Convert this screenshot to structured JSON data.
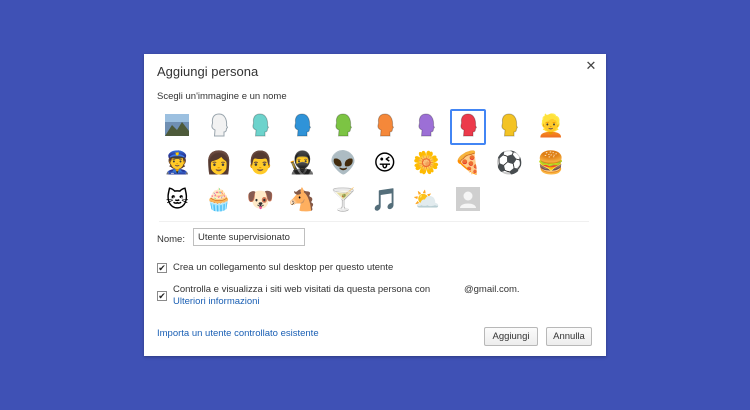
{
  "dialog": {
    "title": "Aggiungi persona",
    "close_glyph": "✕",
    "subtitle": "Scegli un'immagine e un nome"
  },
  "avatars": [
    {
      "icon": "landscape-photo-icon",
      "type": "photo"
    },
    {
      "icon": "head-white-icon",
      "type": "head",
      "color": "#f2f2f2"
    },
    {
      "icon": "head-teal-icon",
      "type": "head",
      "color": "#6dd3cc"
    },
    {
      "icon": "head-blue-icon",
      "type": "head",
      "color": "#2f93d8"
    },
    {
      "icon": "head-green-icon",
      "type": "head",
      "color": "#7cc443"
    },
    {
      "icon": "head-orange-icon",
      "type": "head",
      "color": "#f5883a"
    },
    {
      "icon": "head-purple-icon",
      "type": "head",
      "color": "#9c6fd6"
    },
    {
      "icon": "head-red-icon",
      "type": "head",
      "color": "#ec3a4b",
      "selected": true
    },
    {
      "icon": "head-yellow-icon",
      "type": "head",
      "color": "#f3c324"
    },
    {
      "icon": "blonde-woman-icon",
      "type": "emoji",
      "glyph": "👱"
    },
    {
      "icon": "cop-icon",
      "type": "emoji",
      "glyph": "👮"
    },
    {
      "icon": "woman-sunglasses-icon",
      "type": "emoji",
      "glyph": "👩"
    },
    {
      "icon": "man-icon",
      "type": "emoji",
      "glyph": "👨"
    },
    {
      "icon": "ninja-icon",
      "type": "emoji",
      "glyph": "🥷"
    },
    {
      "icon": "alien-icon",
      "type": "emoji",
      "glyph": "👽"
    },
    {
      "icon": "smiley-icon",
      "type": "emoji",
      "glyph": "😜"
    },
    {
      "icon": "flower-icon",
      "type": "emoji",
      "glyph": "🌼"
    },
    {
      "icon": "pizza-icon",
      "type": "emoji",
      "glyph": "🍕"
    },
    {
      "icon": "soccer-ball-icon",
      "type": "emoji",
      "glyph": "⚽"
    },
    {
      "icon": "burger-icon",
      "type": "emoji",
      "glyph": "🍔"
    },
    {
      "icon": "cat-icon",
      "type": "emoji",
      "glyph": "🐱"
    },
    {
      "icon": "cupcake-icon",
      "type": "emoji",
      "glyph": "🧁"
    },
    {
      "icon": "dog-icon",
      "type": "emoji",
      "glyph": "🐶"
    },
    {
      "icon": "horse-icon",
      "type": "emoji",
      "glyph": "🐴"
    },
    {
      "icon": "cocktail-icon",
      "type": "emoji",
      "glyph": "🍸"
    },
    {
      "icon": "music-note-icon",
      "type": "emoji",
      "glyph": "🎵"
    },
    {
      "icon": "sun-cloud-icon",
      "type": "emoji",
      "glyph": "⛅"
    },
    {
      "icon": "generic-profile-icon",
      "type": "profile"
    }
  ],
  "form": {
    "name_label": "Nome:",
    "name_value": "Utente supervisionato"
  },
  "checkboxes": {
    "desktop_shortcut": {
      "label": "Crea un collegamento sul desktop per questo utente",
      "checked": true
    },
    "supervise": {
      "label": "Controlla e visualizza i siti web visitati da questa persona con",
      "email": "@gmail.com.",
      "link": "Ulteriori informazioni",
      "checked": true
    },
    "check_glyph": "✔"
  },
  "footer": {
    "import_link": "Importa un utente controllato esistente",
    "add_button": "Aggiungi",
    "cancel_button": "Annulla"
  }
}
